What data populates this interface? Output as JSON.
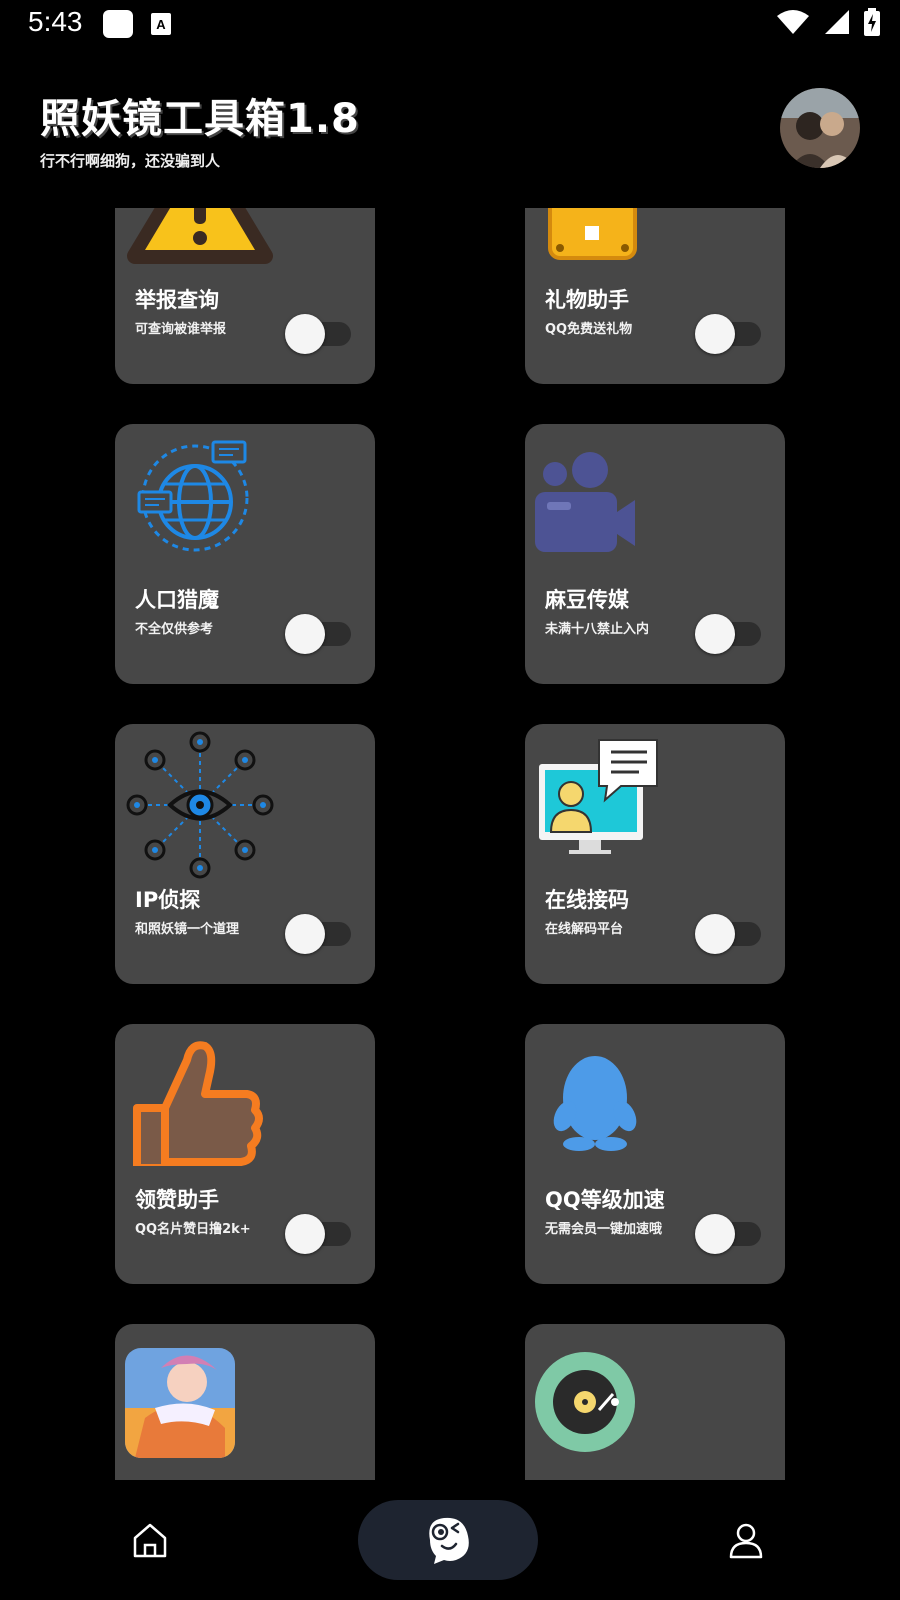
{
  "status_bar": {
    "time": "5:43"
  },
  "header": {
    "title": "照妖镜工具箱1.8",
    "subtitle": "行不行啊细狗，还没骗到人"
  },
  "cards": [
    {
      "title": "举报查询",
      "desc": "可查询被谁举报",
      "icon": "warning-icon",
      "enabled": false
    },
    {
      "title": "礼物助手",
      "desc": "QQ免费送礼物",
      "icon": "gift-box-icon",
      "enabled": false
    },
    {
      "title": "人口猎魔",
      "desc": "不全仅供参考",
      "icon": "globe-chat-icon",
      "enabled": false
    },
    {
      "title": "麻豆传媒",
      "desc": "未满十八禁止入内",
      "icon": "video-camera-icon",
      "enabled": false
    },
    {
      "title": "IP侦探",
      "desc": "和照妖镜一个道理",
      "icon": "eye-network-icon",
      "enabled": false
    },
    {
      "title": "在线接码",
      "desc": "在线解码平台",
      "icon": "monitor-chat-icon",
      "enabled": false
    },
    {
      "title": "领赞助手",
      "desc": "QQ名片赞日撸2k+",
      "icon": "thumbs-up-icon",
      "enabled": false
    },
    {
      "title": "QQ等级加速",
      "desc": "无需会员一键加速哦",
      "icon": "qq-penguin-icon",
      "enabled": false
    },
    {
      "title": "",
      "desc": "",
      "icon": "game-character-icon",
      "enabled": false
    },
    {
      "title": "",
      "desc": "",
      "icon": "music-disc-icon",
      "enabled": false
    }
  ],
  "bottom_nav": {
    "items": [
      "home-icon",
      "mascot-icon",
      "profile-icon"
    ]
  },
  "colors": {
    "background": "#000000",
    "card": "#474747",
    "accent_blue": "#1e88e5",
    "orange": "#f57c20"
  }
}
